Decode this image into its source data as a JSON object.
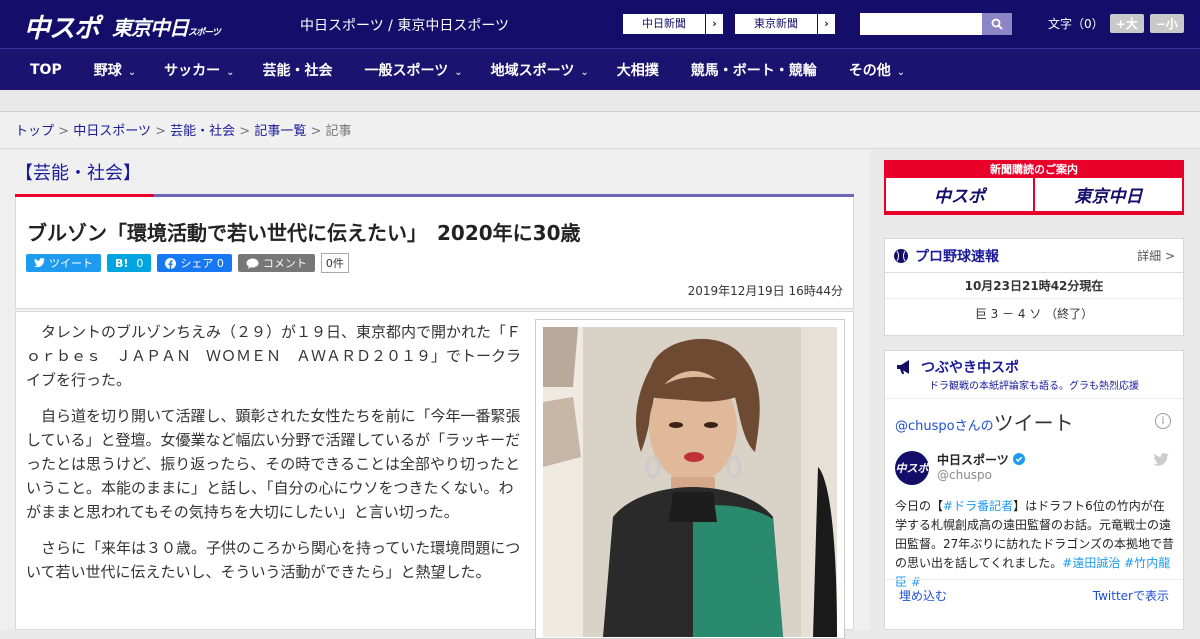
{
  "header": {
    "logo_primary": "中スポ",
    "logo_secondary": "東京中日",
    "logo_secondary_small": "スポーツ",
    "site_title": "中日スポーツ / 東京中日スポーツ",
    "newspaper_buttons": [
      {
        "label": "中日新聞",
        "arrow": "›"
      },
      {
        "label": "東京新聞",
        "arrow": "›"
      }
    ],
    "search": {
      "placeholder": "",
      "icon": "search-icon"
    },
    "font_size": {
      "label": "文字（0）",
      "increase": "+大",
      "decrease": "−小"
    },
    "colors": {
      "header_bg": "#140e6a",
      "accent": "#e8002b"
    }
  },
  "nav": {
    "items": [
      {
        "label": "TOP",
        "chevron": ""
      },
      {
        "label": "野球",
        "chevron": "⌄"
      },
      {
        "label": "サッカー",
        "chevron": "⌄"
      },
      {
        "label": "芸能・社会",
        "chevron": ""
      },
      {
        "label": "一般スポーツ",
        "chevron": "⌄"
      },
      {
        "label": "地域スポーツ",
        "chevron": "⌄"
      },
      {
        "label": "大相撲",
        "chevron": ""
      },
      {
        "label": "競馬・ボート・競輪",
        "chevron": ""
      },
      {
        "label": "その他",
        "chevron": "⌄"
      }
    ]
  },
  "breadcrumb": {
    "items": [
      "トップ",
      "中日スポーツ",
      "芸能・社会",
      "記事一覧"
    ],
    "separator": ">",
    "current": "記事"
  },
  "article": {
    "category": "【芸能・社会】",
    "headline": "ブルゾン「環境活動で若い世代に伝えたい」　2020年に30歳",
    "share": {
      "tweet": "ツイート",
      "hatena_logo": "B!",
      "hatena_count": "0",
      "facebook": "シェア 0",
      "comment": "コメント",
      "comment_count": "0件"
    },
    "date": "2019年12月19日 16時44分",
    "paragraphs": [
      "タレントのブルゾンちえみ（２９）が１９日、東京都内で開かれた「Ｆｏｒｂｅｓ　ＪＡＰＡＮ　ＷＯＭＥＮ　ＡＷＡＲＤ２０１９」でトークライブを行った。",
      "自ら道を切り開いて活躍し、顕彰された女性たちを前に「今年一番緊張している」と登壇。女優業など幅広い分野で活躍しているが「ラッキーだったとは思うけど、振り返ったら、その時できることは全部やり切ったということ。本能のままに」と話し、「自分の心にウソをつきたくない。わがままと思われてもその気持ちを大切にしたい」と言い切った。",
      "さらに「来年は３０歳。子供のころから関心を持っていた環境問題について若い世代に伝えたいし、そういう活動ができたら」と熱望した。"
    ]
  },
  "sidebar": {
    "subscribe": {
      "title": "新聞購読のご案内",
      "logo1": "中スポ",
      "logo2": "東京中日"
    },
    "baseball": {
      "title": "プロ野球速報",
      "more": "詳細 >",
      "updated": "10月23日21時42分現在",
      "score": "巨 3 － 4 ソ （終了）"
    },
    "twitter": {
      "title": "つぶやき中スポ",
      "subtitle": "ドラ観戦の本紙評論家も語る。グラも熱烈応援",
      "handle_prefix": "@chuspoさんの",
      "handle_suffix": "ツイート",
      "info": "i",
      "user_name": "中日スポーツ",
      "user_handle": "@chuspo",
      "avatar_text": "中スポ",
      "tweet_pre": "今日の【",
      "tweet_tag1": "#ドラ番記者",
      "tweet_mid": "】はドラフト6位の竹内が在学する札幌創成高の遠田監督のお話。元竜戦士の遠田監督。27年ぶりに訪れたドラゴンズの本拠地で昔の思い出を話してくれました。",
      "tweet_tags": "#遠田誠治 #竹内龍臣 #",
      "embed": "埋め込む",
      "view": "Twitterで表示"
    }
  }
}
